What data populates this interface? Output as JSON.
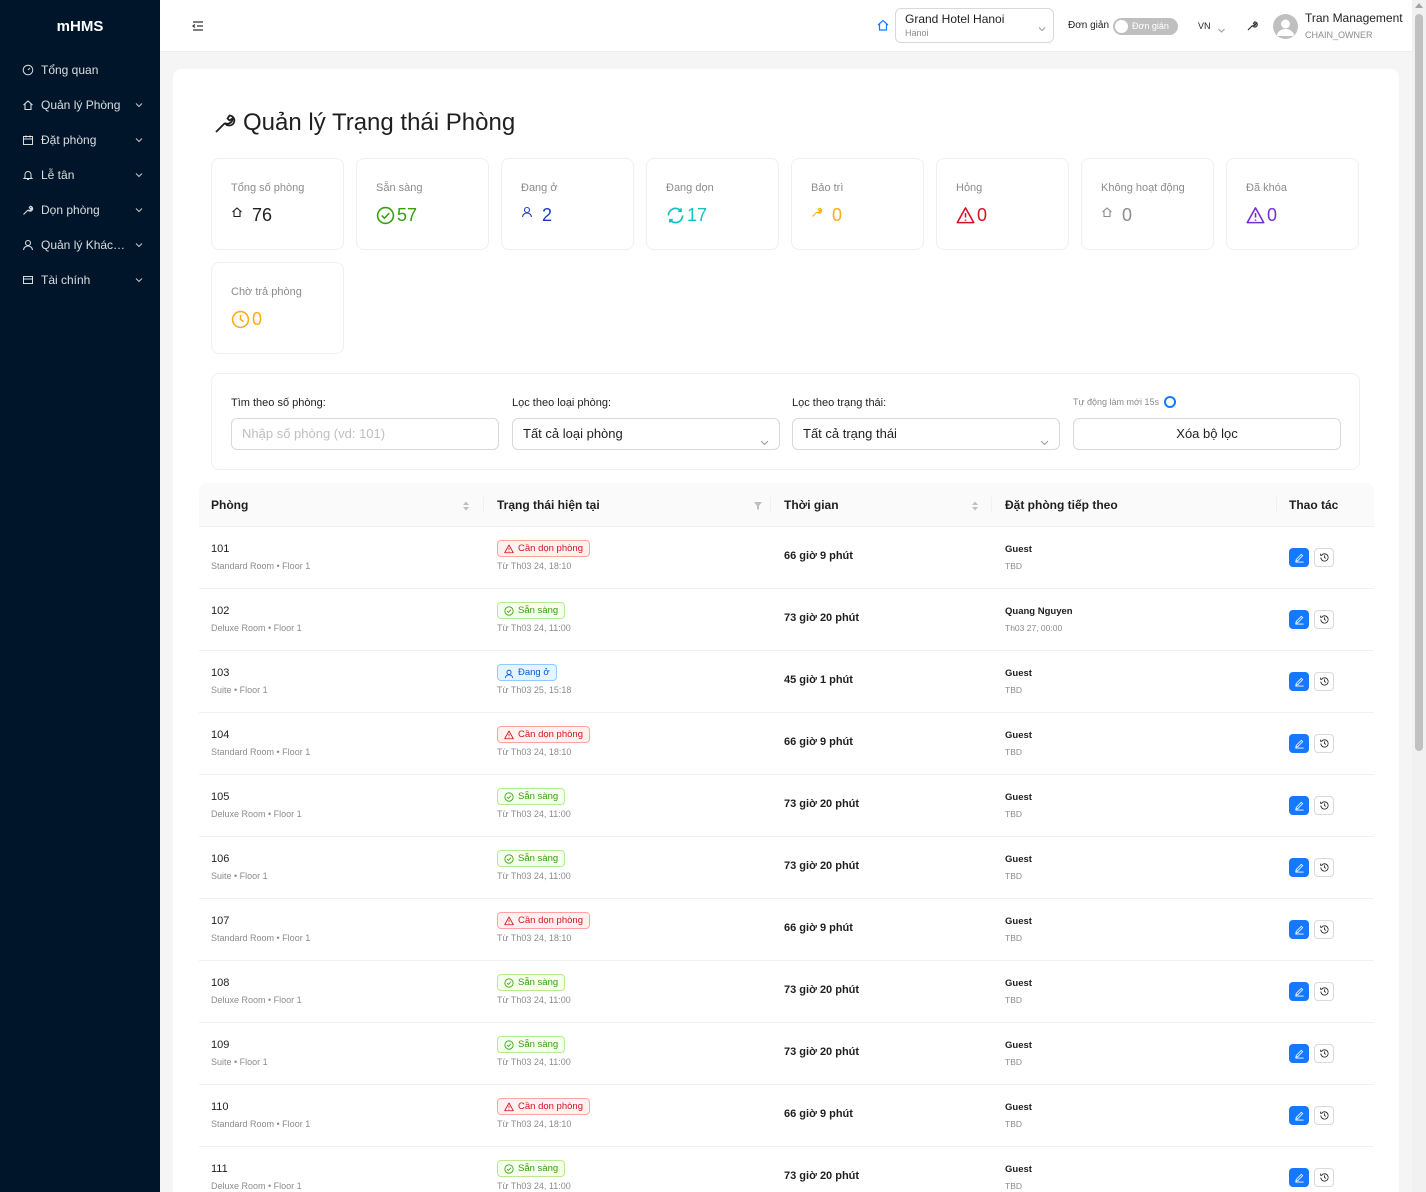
{
  "sidebar": {
    "brand": "mHMS",
    "items": [
      {
        "label": "Tổng quan",
        "icon": "dashboard-icon"
      },
      {
        "label": "Quản lý Phòng",
        "icon": "home-icon"
      },
      {
        "label": "Đặt phòng",
        "icon": "calendar-icon"
      },
      {
        "label": "Lễ tân",
        "icon": "bell-icon"
      },
      {
        "label": "Dọn phòng",
        "icon": "tool-icon"
      },
      {
        "label": "Quản lý Khách ...",
        "icon": "user-icon"
      },
      {
        "label": "Tài chính",
        "icon": "wallet-icon"
      }
    ]
  },
  "header": {
    "hotel": {
      "name": "Grand Hotel Hanoi",
      "city": "Hanoi"
    },
    "simple_mode_label": "Đơn giản",
    "toggle_text": "Đơn giản",
    "language": "VN",
    "user": {
      "name": "Tran Management",
      "role": "CHAIN_OWNER"
    }
  },
  "page": {
    "title": "Quản lý Trạng thái Phòng",
    "stats": [
      {
        "label": "Tổng số phòng",
        "value": "76",
        "icon": "home-icon",
        "color": "#1f1f1f"
      },
      {
        "label": "Sẵn sàng",
        "value": "57",
        "icon": "check-circle-icon",
        "color": "#389e0d"
      },
      {
        "label": "Đang ở",
        "value": "2",
        "icon": "user-icon",
        "color": "#1d39c4"
      },
      {
        "label": "Đang dọn",
        "value": "17",
        "icon": "sync-icon",
        "color": "#13c2c2"
      },
      {
        "label": "Bảo trì",
        "value": "0",
        "icon": "tool-icon",
        "color": "#faad14"
      },
      {
        "label": "Hỏng",
        "value": "0",
        "icon": "warning-icon",
        "color": "#cf1322"
      },
      {
        "label": "Không hoạt động",
        "value": "0",
        "icon": "home-icon",
        "color": "#8c8c8c"
      },
      {
        "label": "Đã khóa",
        "value": "0",
        "icon": "warning-icon",
        "color": "#722ed1"
      },
      {
        "label": "Chờ trả phòng",
        "value": "0",
        "icon": "clock-icon",
        "color": "#faad14"
      }
    ],
    "filters": {
      "search_label": "Tìm theo số phòng:",
      "search_placeholder": "Nhập số phòng (vd: 101)",
      "type_label": "Lọc theo loại phòng:",
      "type_value": "Tất cả loại phòng",
      "status_label": "Lọc theo trạng thái:",
      "status_value": "Tất cả trạng thái",
      "auto_refresh": "Tự động làm mới 15s",
      "clear_button": "Xóa bộ lọc"
    },
    "table": {
      "columns": [
        "Phòng",
        "Trạng thái hiện tại",
        "Thời gian",
        "Đặt phòng tiếp theo",
        "Thao tác"
      ],
      "rows": [
        {
          "room": "101",
          "type": "Standard Room • Floor 1",
          "status": "Cần dọn phòng",
          "status_kind": "clean",
          "since": "Từ Th03 24, 18:10",
          "duration": "66 giờ 9 phút",
          "next_guest": "Guest",
          "next_date": "TBD"
        },
        {
          "room": "102",
          "type": "Deluxe Room • Floor 1",
          "status": "Sẵn sàng",
          "status_kind": "ready",
          "since": "Từ Th03 24, 11:00",
          "duration": "73 giờ 20 phút",
          "next_guest": "Quang Nguyen",
          "next_date": "Th03 27, 00:00"
        },
        {
          "room": "103",
          "type": "Suite • Floor 1",
          "status": "Đang ở",
          "status_kind": "occ",
          "since": "Từ Th03 25, 15:18",
          "duration": "45 giờ 1 phút",
          "next_guest": "Guest",
          "next_date": "TBD"
        },
        {
          "room": "104",
          "type": "Standard Room • Floor 1",
          "status": "Cần dọn phòng",
          "status_kind": "clean",
          "since": "Từ Th03 24, 18:10",
          "duration": "66 giờ 9 phút",
          "next_guest": "Guest",
          "next_date": "TBD"
        },
        {
          "room": "105",
          "type": "Deluxe Room • Floor 1",
          "status": "Sẵn sàng",
          "status_kind": "ready",
          "since": "Từ Th03 24, 11:00",
          "duration": "73 giờ 20 phút",
          "next_guest": "Guest",
          "next_date": "TBD"
        },
        {
          "room": "106",
          "type": "Suite • Floor 1",
          "status": "Sẵn sàng",
          "status_kind": "ready",
          "since": "Từ Th03 24, 11:00",
          "duration": "73 giờ 20 phút",
          "next_guest": "Guest",
          "next_date": "TBD"
        },
        {
          "room": "107",
          "type": "Standard Room • Floor 1",
          "status": "Cần dọn phòng",
          "status_kind": "clean",
          "since": "Từ Th03 24, 18:10",
          "duration": "66 giờ 9 phút",
          "next_guest": "Guest",
          "next_date": "TBD"
        },
        {
          "room": "108",
          "type": "Deluxe Room • Floor 1",
          "status": "Sẵn sàng",
          "status_kind": "ready",
          "since": "Từ Th03 24, 11:00",
          "duration": "73 giờ 20 phút",
          "next_guest": "Guest",
          "next_date": "TBD"
        },
        {
          "room": "109",
          "type": "Suite • Floor 1",
          "status": "Sẵn sàng",
          "status_kind": "ready",
          "since": "Từ Th03 24, 11:00",
          "duration": "73 giờ 20 phút",
          "next_guest": "Guest",
          "next_date": "TBD"
        },
        {
          "room": "110",
          "type": "Standard Room • Floor 1",
          "status": "Cần dọn phòng",
          "status_kind": "clean",
          "since": "Từ Th03 24, 18:10",
          "duration": "66 giờ 9 phút",
          "next_guest": "Guest",
          "next_date": "TBD"
        },
        {
          "room": "111",
          "type": "Deluxe Room • Floor 1",
          "status": "Sẵn sàng",
          "status_kind": "ready",
          "since": "Từ Th03 24, 11:00",
          "duration": "73 giờ 20 phút",
          "next_guest": "Guest",
          "next_date": "TBD"
        }
      ]
    }
  }
}
